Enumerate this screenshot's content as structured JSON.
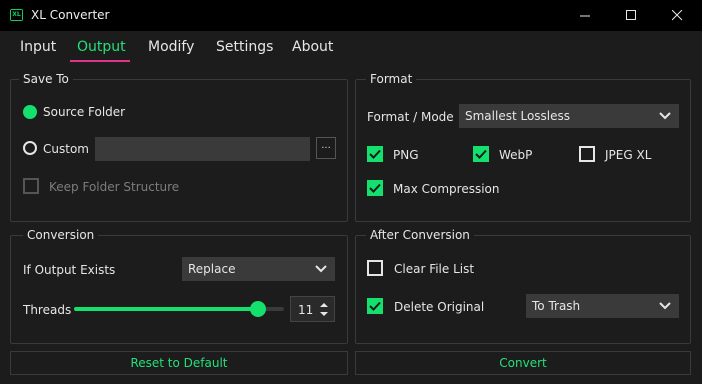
{
  "window": {
    "title": "XL Converter",
    "icon_text": "XL",
    "controls": [
      "minimize",
      "maximize",
      "close"
    ]
  },
  "tabs": [
    {
      "label": "Input",
      "active": false
    },
    {
      "label": "Output",
      "active": true
    },
    {
      "label": "Modify",
      "active": false
    },
    {
      "label": "Settings",
      "active": false
    },
    {
      "label": "About",
      "active": false
    }
  ],
  "save_to": {
    "title": "Save To",
    "source_folder_label": "Source Folder",
    "source_folder_selected": true,
    "custom_label": "Custom",
    "custom_selected": false,
    "custom_path": "",
    "browse_label": "...",
    "keep_structure_label": "Keep Folder Structure",
    "keep_structure_checked": false,
    "keep_structure_enabled": false
  },
  "format": {
    "title": "Format",
    "mode_label": "Format / Mode",
    "mode_value": "Smallest Lossless",
    "png_label": "PNG",
    "png_checked": true,
    "webp_label": "WebP",
    "webp_checked": true,
    "jxl_label": "JPEG XL",
    "jxl_checked": false,
    "max_compression_label": "Max Compression",
    "max_compression_checked": true
  },
  "conversion": {
    "title": "Conversion",
    "if_exists_label": "If Output Exists",
    "if_exists_value": "Replace",
    "threads_label": "Threads",
    "threads_value": "11",
    "threads_max": 12
  },
  "after_conversion": {
    "title": "After Conversion",
    "clear_list_label": "Clear File List",
    "clear_list_checked": false,
    "delete_original_label": "Delete Original",
    "delete_original_checked": true,
    "delete_mode_value": "To Trash"
  },
  "buttons": {
    "reset_label": "Reset to Default",
    "convert_label": "Convert"
  },
  "colors": {
    "accent_green": "#14e06e",
    "tab_underline": "#e0338a",
    "background": "#1c1c1c",
    "titlebar": "#000000"
  }
}
